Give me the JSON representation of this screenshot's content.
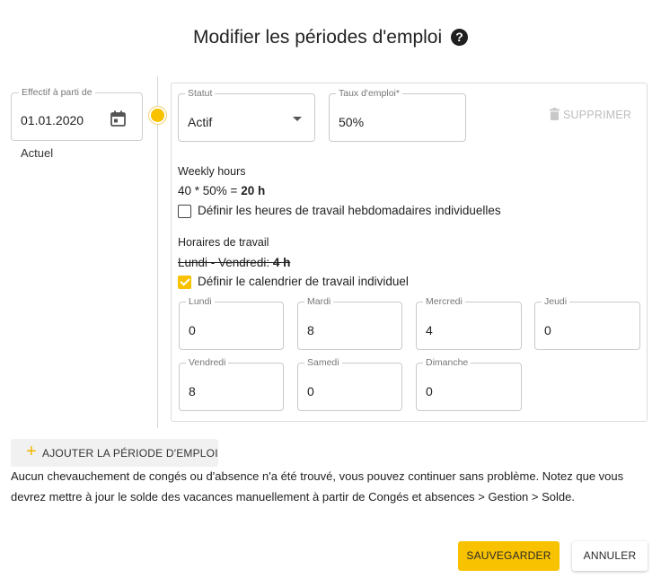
{
  "dialog": {
    "title": "Modifier les périodes d'emploi",
    "help_icon": "question-circle-icon"
  },
  "period": {
    "date_label": "Effectif à parti de",
    "date_value": "01.01.2020",
    "calendar_icon": "calendar-icon",
    "current_label": "Actuel"
  },
  "form": {
    "status": {
      "label": "Statut",
      "value": "Actif"
    },
    "rate": {
      "label": "Taux d'emploi*",
      "value": "50%"
    },
    "delete_label": "SUPPRIMER",
    "delete_icon": "trash-icon",
    "weekly": {
      "title": "Weekly hours",
      "formula_prefix": "40 * 50% = ",
      "formula_result": "20 h",
      "checkbox_label": "Définir les heures de travail hebdomadaires individuelles",
      "checked": false
    },
    "schedule": {
      "title": "Horaires de travail",
      "summary_prefix": "Lundi - Vendredi: ",
      "summary_value": "4 h",
      "checkbox_label": "Définir le calendrier de travail individuel",
      "checked": true
    },
    "days": [
      {
        "label": "Lundi",
        "value": "0"
      },
      {
        "label": "Mardi",
        "value": "8"
      },
      {
        "label": "Mercredi",
        "value": "4"
      },
      {
        "label": "Jeudi",
        "value": "0"
      },
      {
        "label": "Vendredi",
        "value": "8"
      },
      {
        "label": "Samedi",
        "value": "0"
      },
      {
        "label": "Dimanche",
        "value": "0"
      }
    ]
  },
  "add_period_label": "AJOUTER LA PÉRIODE D'EMPLOI",
  "notice": "Aucun chevauchement de congés ou d'absence n'a été trouvé, vous pouvez continuer sans problème. Notez que vous devrez mettre à jour le solde des vacances manuellement à partir de Congés et absences > Gestion > Solde.",
  "buttons": {
    "save": "SAUVEGARDER",
    "cancel": "ANNULER"
  },
  "colors": {
    "accent": "#f8c200",
    "muted": "#bdbdbd"
  }
}
